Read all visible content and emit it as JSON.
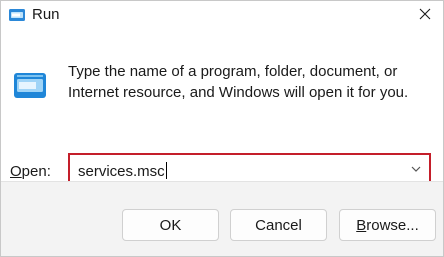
{
  "window": {
    "title": "Run",
    "icon": "run-app-icon"
  },
  "titlebar": {
    "close_icon": "close-icon"
  },
  "main": {
    "icon": "run-dialog-icon",
    "description": "Type the name of a program, folder, document, or Internet resource, and Windows will open it for you.",
    "open_label_accel": "O",
    "open_label_rest": "pen:",
    "input_value": "services.msc",
    "dropdown_icon": "chevron-down-icon",
    "highlight_color": "#c41e2a"
  },
  "buttons": {
    "ok": "OK",
    "cancel": "Cancel",
    "browse_accel": "B",
    "browse_rest": "rowse..."
  }
}
